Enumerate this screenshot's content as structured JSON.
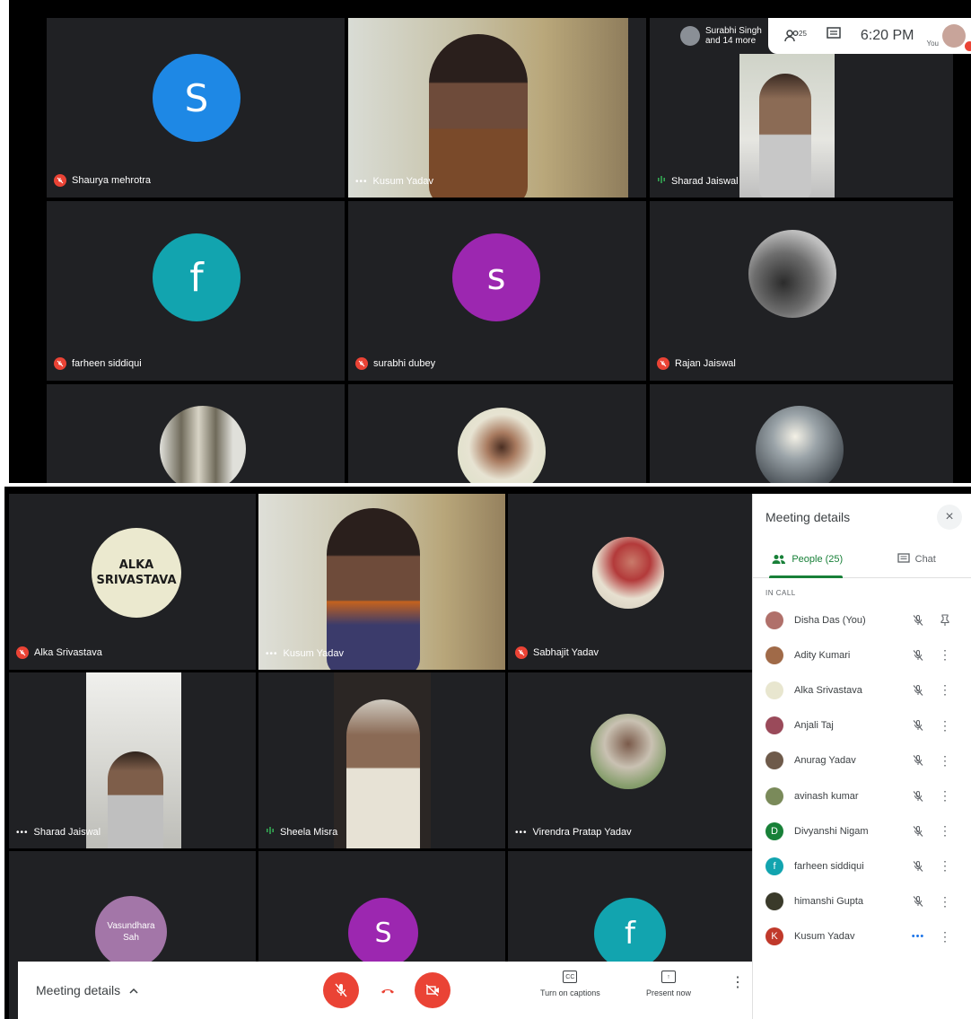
{
  "top": {
    "header": {
      "others_text_1": "Surabhi Singh",
      "others_text_2": "and 14 more",
      "people_count": "25",
      "time": "6:20 PM",
      "you_label": "You"
    },
    "tiles": [
      {
        "name": "Shaurya mehrotra",
        "initial": "S",
        "color": "#1e88e5",
        "status": "muted"
      },
      {
        "name": "Kusum Yadav",
        "status": "dots",
        "video": true
      },
      {
        "name": "Sharad Jaiswal",
        "status": "speaking",
        "video": true
      },
      {
        "name": "farheen siddiqui",
        "initial": "f",
        "color": "#12a4af",
        "status": "muted"
      },
      {
        "name": "surabhi dubey",
        "initial": "s",
        "color": "#9c27b0",
        "status": "muted"
      },
      {
        "name": "Rajan Jaiswal",
        "status": "muted",
        "photo": true
      }
    ]
  },
  "bottom": {
    "tiles": [
      {
        "name": "Alka Srivastava",
        "status": "muted",
        "avatar_text_1": "ALKA",
        "avatar_text_2": "SRIVASTAVA"
      },
      {
        "name": "Kusum Yadav",
        "status": "dots",
        "video": true
      },
      {
        "name": "Sabhajit Yadav",
        "status": "muted",
        "photo": true
      },
      {
        "name": "Sharad Jaiswal",
        "status": "dots",
        "video": true
      },
      {
        "name": "Sheela Misra",
        "status": "speaking",
        "video": true
      },
      {
        "name": "Virendra Pratap Yadav",
        "status": "dots",
        "photo": true
      },
      {
        "avatar_text_1": "Vasundhara",
        "avatar_text_2": "Sah"
      },
      {
        "initial": "S",
        "color": "#9c27b0"
      },
      {
        "initial": "f",
        "color": "#12a4af"
      }
    ],
    "panel": {
      "title": "Meeting details",
      "close_symbol": "×",
      "tab_people": "People (25)",
      "tab_chat": "Chat",
      "section": "IN CALL",
      "people": [
        {
          "name": "Disha Das (You)",
          "color": "#b0706a",
          "initial": "",
          "action": "pin"
        },
        {
          "name": "Adity Kumari",
          "color": "#a06a48",
          "initial": "",
          "action": "more"
        },
        {
          "name": "Alka Srivastava",
          "color": "#e8e6cf",
          "initial": "",
          "action": "more"
        },
        {
          "name": "Anjali Taj",
          "color": "#9a4a5a",
          "initial": "",
          "action": "more"
        },
        {
          "name": "Anurag Yadav",
          "color": "#6e5a4a",
          "initial": "",
          "action": "more"
        },
        {
          "name": "avinash kumar",
          "color": "#7a8a5a",
          "initial": "",
          "action": "more"
        },
        {
          "name": "Divyanshi Nigam",
          "color": "#188038",
          "initial": "D",
          "action": "more"
        },
        {
          "name": "farheen siddiqui",
          "color": "#12a4af",
          "initial": "f",
          "action": "more"
        },
        {
          "name": "himanshi Gupta",
          "color": "#3a3a2a",
          "initial": "",
          "action": "more"
        },
        {
          "name": "Kusum Yadav",
          "color": "#c0392b",
          "initial": "K",
          "action": "more",
          "speaking": true
        }
      ]
    },
    "bar": {
      "meeting_details": "Meeting details",
      "captions": "Turn on captions",
      "present": "Present now",
      "cc": "CC"
    }
  }
}
